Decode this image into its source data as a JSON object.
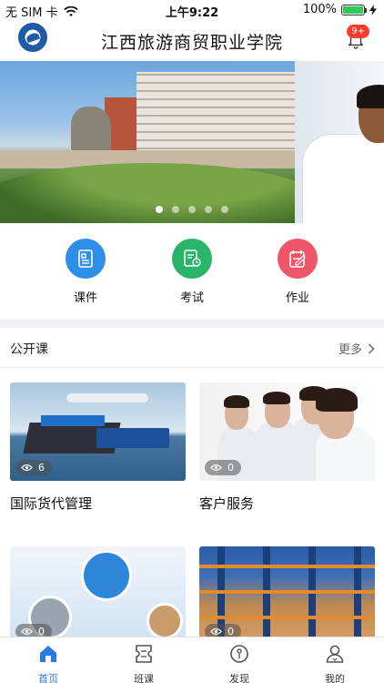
{
  "status_bar": {
    "carrier": "无 SIM 卡",
    "time": "上午9:22",
    "battery": "100%"
  },
  "header": {
    "title": "江西旅游商贸职业学院",
    "notification_badge": "9+"
  },
  "banner": {
    "slide_count": 5,
    "active_index": 0
  },
  "actions": [
    {
      "label": "课件",
      "color": "#2f8fe8",
      "icon": "courseware-icon"
    },
    {
      "label": "考试",
      "color": "#28b56a",
      "icon": "exam-icon"
    },
    {
      "label": "作业",
      "color": "#f0566a",
      "icon": "homework-icon"
    }
  ],
  "public_courses": {
    "title": "公开课",
    "more_label": "更多",
    "courses": [
      {
        "title": "国际货代管理",
        "views": "6"
      },
      {
        "title": "客户服务",
        "views": "0"
      },
      {
        "title": "",
        "views": "0"
      },
      {
        "title": "",
        "views": "0"
      }
    ]
  },
  "tabbar": {
    "items": [
      {
        "label": "首页",
        "icon": "home-icon",
        "active": true
      },
      {
        "label": "班课",
        "icon": "class-icon",
        "active": false
      },
      {
        "label": "发现",
        "icon": "discover-icon",
        "active": false
      },
      {
        "label": "我的",
        "icon": "profile-icon",
        "active": false
      }
    ],
    "active_color": "#2a7ae4"
  }
}
